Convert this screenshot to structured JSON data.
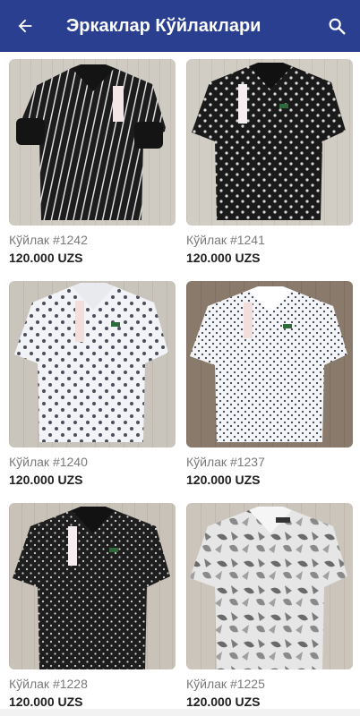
{
  "header": {
    "title": "Эркаклар Кўйлаклари",
    "back_icon": "arrow-left-icon",
    "search_icon": "search-icon",
    "background": "#2a3f8f"
  },
  "products": [
    {
      "name": "Кўйлак #1242",
      "price": "120.000 UZS",
      "shirt_color": "#1c1c1c",
      "pattern": "stripes"
    },
    {
      "name": "Кўйлак #1241",
      "price": "120.000 UZS",
      "shirt_color": "#1a1a1a",
      "pattern": "dots"
    },
    {
      "name": "Кўйлак #1240",
      "price": "120.000 UZS",
      "shirt_color": "#f2f3f6",
      "pattern": "dots"
    },
    {
      "name": "Кўйлак #1237",
      "price": "120.000 UZS",
      "shirt_color": "#f4f5f7",
      "pattern": "dots"
    },
    {
      "name": "Кўйлак #1228",
      "price": "120.000 UZS",
      "shirt_color": "#1e1e1e",
      "pattern": "dots"
    },
    {
      "name": "Кўйлак #1225",
      "price": "120.000 UZS",
      "shirt_color": "#dcdcdc",
      "pattern": "floral"
    }
  ]
}
